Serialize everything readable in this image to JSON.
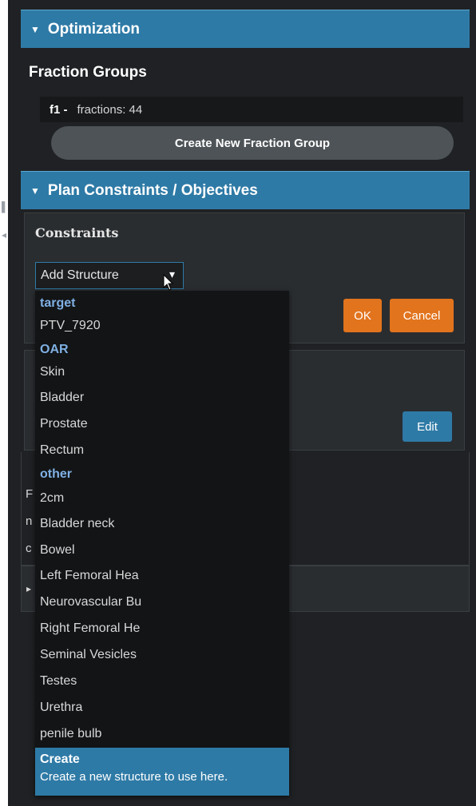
{
  "optimization": {
    "header": "Optimization"
  },
  "fraction_groups": {
    "title": "Fraction Groups",
    "rows": [
      {
        "id": "f1 -",
        "text": "fractions: 44"
      }
    ],
    "create_button": "Create New Fraction Group"
  },
  "plan_constraints": {
    "header": "Plan Constraints / Objectives",
    "constraints_title": "Constraints",
    "select": {
      "value": "Add Structure"
    },
    "ok_label": "OK",
    "cancel_label": "Cancel",
    "edit_label": "Edit"
  },
  "dropdown": {
    "groups": [
      {
        "label": "target",
        "items": [
          "PTV_7920"
        ]
      },
      {
        "label": "OAR",
        "items": [
          "Skin",
          "Bladder",
          "Prostate",
          "Rectum"
        ]
      },
      {
        "label": "other",
        "items": [
          "2cm",
          "Bladder neck",
          "Bowel",
          "Left Femoral Hea",
          "Neurovascular Bu",
          "Right Femoral He",
          "Seminal Vesicles",
          "Testes",
          "Urethra",
          "penile bulb"
        ]
      }
    ],
    "create": {
      "title": "Create",
      "description": "Create a new structure to use here."
    }
  },
  "behind_letters": [
    "F",
    "n",
    "c"
  ]
}
